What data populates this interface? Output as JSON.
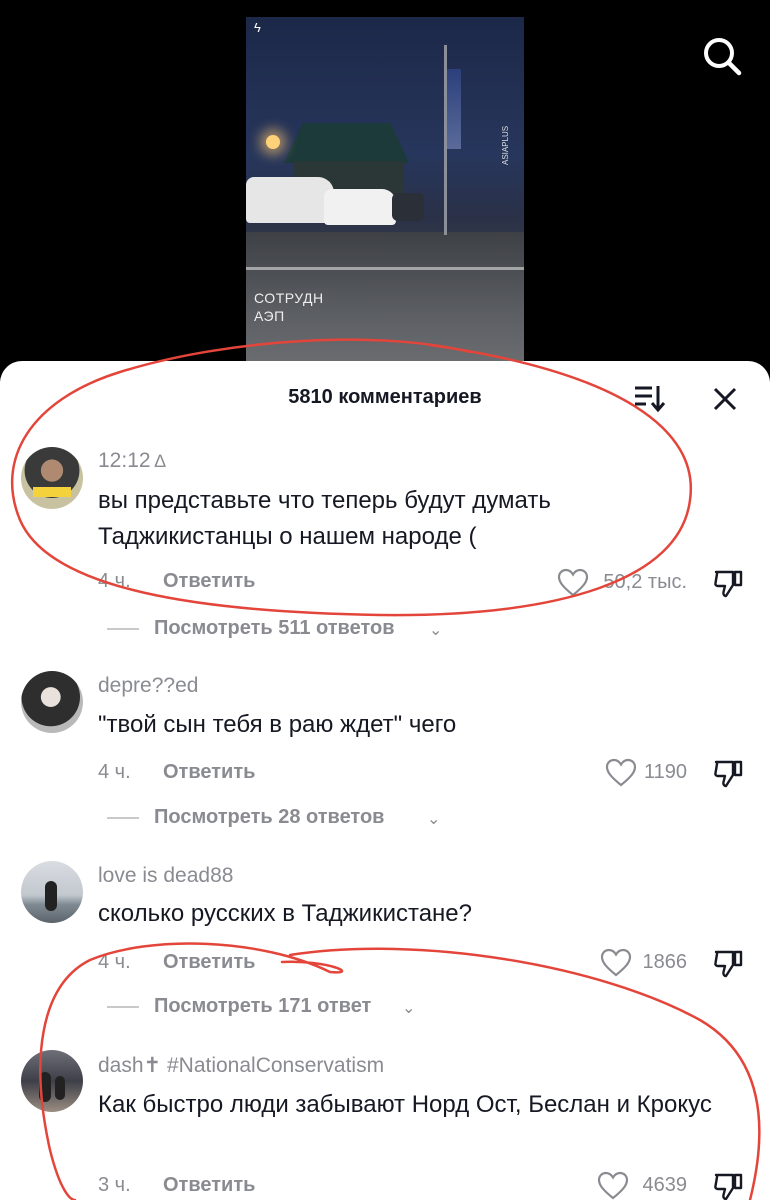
{
  "video": {
    "caption_line1": "СОТРУДН",
    "caption_line2": "АЭП",
    "watermark": "ASIAPLUS"
  },
  "sheet": {
    "title": "5810 комментариев"
  },
  "comments": [
    {
      "author": "12:12",
      "text": "вы представьте что теперь будут думать Таджикистанцы о нашем народе (",
      "time": "4 ч.",
      "reply": "Ответить",
      "likes": "50,2 тыс.",
      "view_replies": "Посмотреть 511 ответов"
    },
    {
      "author": "depre??ed",
      "text": "\"твой сын тебя в раю ждет\" чего",
      "time": "4 ч.",
      "reply": "Ответить",
      "likes": "1190",
      "view_replies": "Посмотреть 28 ответов"
    },
    {
      "author": "love is dead88",
      "text": "сколько русских в Таджикистане?",
      "time": "4 ч.",
      "reply": "Ответить",
      "likes": "1866",
      "view_replies": "Посмотреть 171 ответ"
    },
    {
      "author": "dash✝ #NationalConservatism",
      "text": "Как быстро люди забывают Норд Ост, Беслан и Крокус",
      "time": "3 ч.",
      "reply": "Ответить",
      "likes": "4639"
    }
  ],
  "icons": {
    "search": "search-icon",
    "sort": "sort-icon",
    "close": "close-icon",
    "like": "heart-icon",
    "dislike": "thumbs-down-icon",
    "pin": "signature-icon",
    "chevron": "chevron-down-icon"
  },
  "colors": {
    "annotation": "#e4453a",
    "text_primary": "#161823",
    "text_secondary": "#8a8b91"
  }
}
